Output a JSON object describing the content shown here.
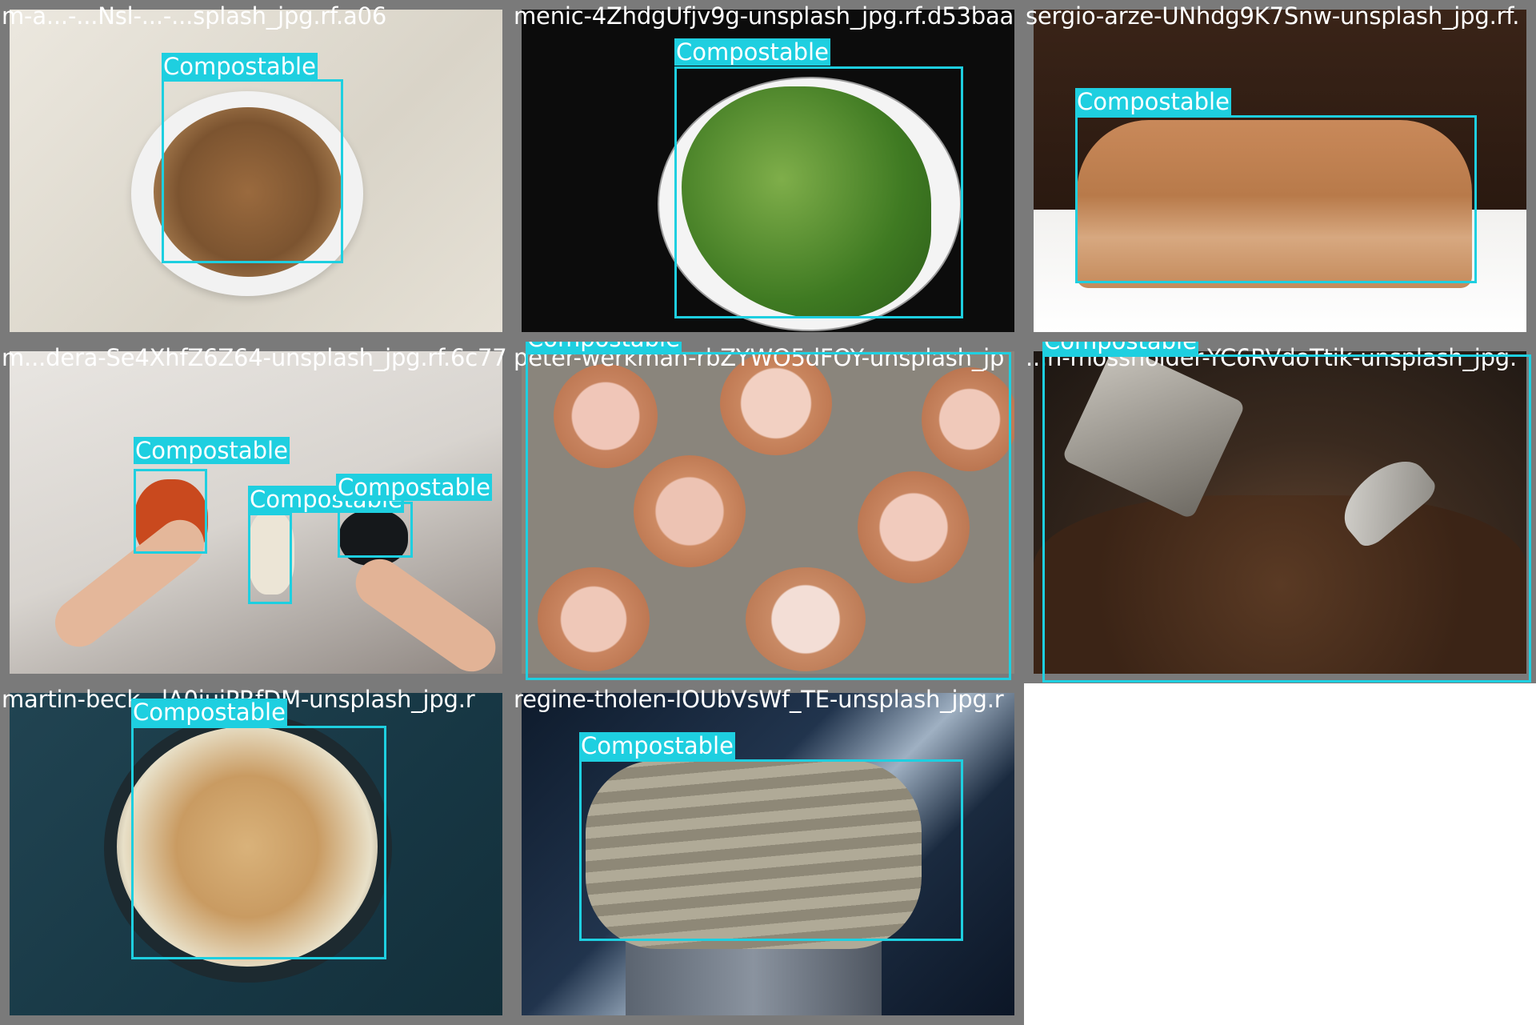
{
  "class_label": "Compostable",
  "tiles": [
    {
      "filename": "m-a...-...Nsl-...-...splash_jpg.rf.a06",
      "subject": "bowl-of-cereal"
    },
    {
      "filename": "menic-4ZhdgUfjv9g-unsplash_jpg.rf.d53baa",
      "subject": "lettuce-on-plate"
    },
    {
      "filename": "sergio-arze-UNhdg9K7Snw-unsplash_jpg.rf.",
      "subject": "loaf-of-bread"
    },
    {
      "filename": "m...dera-Se4XhfZ6Z64-unsplash_jpg.rf.6c77",
      "subject": "hands-with-grains"
    },
    {
      "filename": "peter-werkman-rbZYWO5dFOY-unsplash_jp",
      "subject": "eggshells"
    },
    {
      "filename": "...n-mossholder-YC6RVdoTtik-unsplash_jpg.",
      "subject": "coffee-beans-roasting"
    },
    {
      "filename": "martin-beck...lA0iuiPRfDM-unsplash_jpg.r",
      "subject": "chickpea-stew"
    },
    {
      "filename": "regine-tholen-IOUbVsWf_TE-unsplash_jpg.r",
      "subject": "coiled-rope"
    }
  ],
  "colors": {
    "box": "#1ecfe0",
    "frame": "#7a7a7a",
    "text": "#ffffff"
  }
}
